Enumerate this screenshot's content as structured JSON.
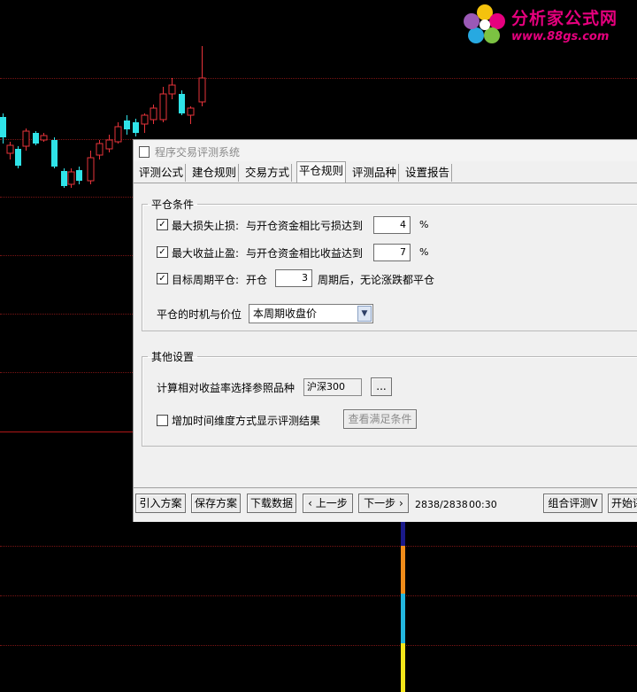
{
  "watermark": {
    "title": "分析家公式网",
    "url": "www.88gs.com"
  },
  "colors": {
    "up": "#e8333a",
    "down": "#2fe3e8",
    "grid": "#7a1515",
    "vol_blue": "#1a1a8a",
    "vol_orange": "#f08c1a",
    "vol_cyan": "#23b7e0",
    "vol_yellow": "#f5e61a"
  },
  "dialog": {
    "title": "程序交易评测系统",
    "tabs": [
      "评测公式",
      "建仓规则",
      "交易方式",
      "平仓规则",
      "评测品种",
      "设置报告"
    ],
    "active_tab": "平仓规则",
    "close_group": {
      "legend": "平仓条件",
      "stop_loss": {
        "checked": true,
        "label": "最大损失止损:",
        "desc": "与开仓资金相比亏损达到",
        "value": "4",
        "unit": "%"
      },
      "take_profit": {
        "checked": true,
        "label": "最大收益止盈:",
        "desc": "与开仓资金相比收益达到",
        "value": "7",
        "unit": "%"
      },
      "period_close": {
        "checked": true,
        "label": "目标周期平仓:",
        "prefix": "开仓",
        "value": "3",
        "suffix": "周期后，无论涨跌都平仓"
      },
      "timing_label": "平仓的时机与价位",
      "timing_value": "本周期收盘价"
    },
    "other_group": {
      "legend": "其他设置",
      "ref_label": "计算相对收益率选择参照品种",
      "ref_value": "沪深300",
      "browse_label": "...",
      "time_dim": {
        "checked": false,
        "label": "增加时间维度方式显示评测结果"
      },
      "view_cond_label": "查看满足条件"
    },
    "footer": {
      "import_label": "引入方案",
      "save_label": "保存方案",
      "download_label": "下载数据",
      "prev_label": "上一步",
      "next_label": "下一步",
      "progress": "2838/2838",
      "time": "00:30",
      "combo_label": "组合评测V",
      "start_label": "开始评"
    }
  }
}
